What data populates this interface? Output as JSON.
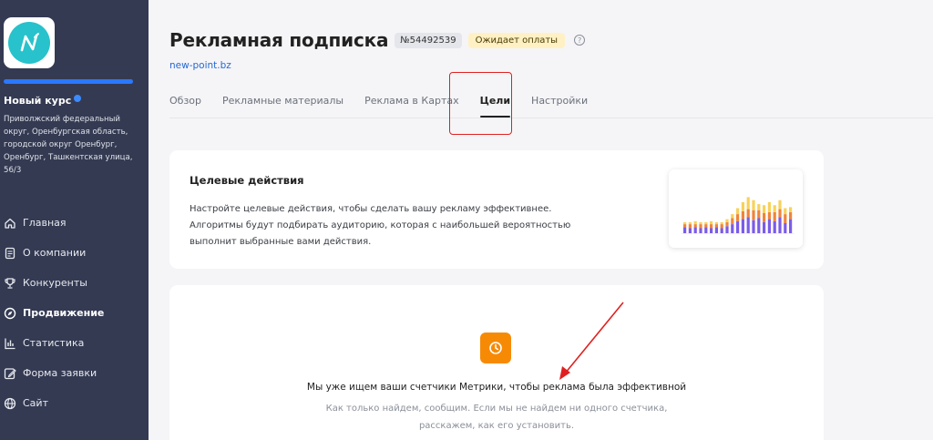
{
  "sidebar": {
    "org_name": "Новый курс",
    "address": "Приволжский федеральный округ, Оренбургская область, городской округ Оренбург, Оренбург, Ташкентская улица, 56/3",
    "progress_percent": 100,
    "nav": [
      {
        "label": "Главная",
        "icon": "home-icon"
      },
      {
        "label": "О компании",
        "icon": "document-icon"
      },
      {
        "label": "Конкуренты",
        "icon": "trophy-icon"
      },
      {
        "label": "Продвижение",
        "icon": "compass-icon",
        "active": true
      },
      {
        "label": "Статистика",
        "icon": "bar-chart-icon"
      },
      {
        "label": "Форма заявки",
        "icon": "edit-form-icon"
      },
      {
        "label": "Сайт",
        "icon": "globe-icon"
      }
    ]
  },
  "header": {
    "title": "Рекламная подписка",
    "id_badge": "№54492539",
    "status_badge": "Ожидает оплаты",
    "site_link": "new-point.bz"
  },
  "tabs": [
    {
      "label": "Обзор"
    },
    {
      "label": "Рекламные материалы"
    },
    {
      "label": "Реклама в Картах"
    },
    {
      "label": "Цели",
      "active": true
    },
    {
      "label": "Настройки"
    }
  ],
  "goal_card": {
    "title": "Целевые действия",
    "text": "Настройте целевые действия, чтобы сделать вашу рекламу эффективнее. Алгоритмы будут подбирать аудиторию, которая с наибольшей вероятностью выполнит выбранные вами действия."
  },
  "search_card": {
    "title": "Мы уже ищем ваши счетчики Метрики, чтобы реклама была эффективной",
    "text": "Как только найдем, сообщим. Если мы не найдем ни одного счетчика, расскажем, как его установить."
  },
  "colors": {
    "sidebar_bg": "#343a52",
    "accent_blue": "#2a78ff",
    "status_bg": "#fff1c4",
    "clock_orange": "#f78a05",
    "annotation_red": "#e02020"
  }
}
